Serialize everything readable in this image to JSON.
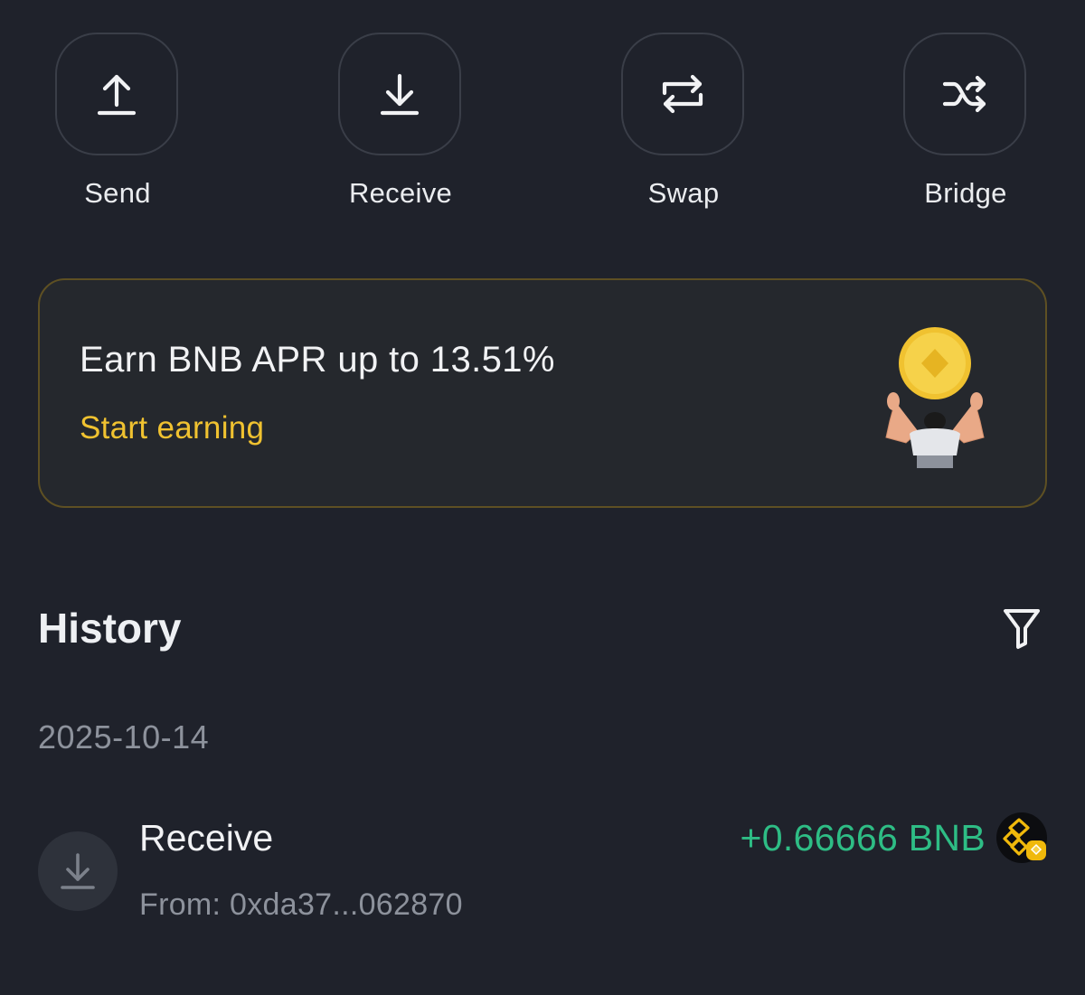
{
  "actions": [
    {
      "label": "Send",
      "icon": "arrow-up-icon"
    },
    {
      "label": "Receive",
      "icon": "arrow-down-icon"
    },
    {
      "label": "Swap",
      "icon": "swap-arrows-icon"
    },
    {
      "label": "Bridge",
      "icon": "shuffle-icon"
    }
  ],
  "promo": {
    "title": "Earn BNB APR up to 13.51%",
    "cta": "Start earning",
    "illustration": "person-holding-coin-illustration"
  },
  "history": {
    "title": "History",
    "filter_icon": "filter-icon",
    "groups": [
      {
        "date": "2025-10-14",
        "transactions": [
          {
            "type": "Receive",
            "from": "From: 0xda37...062870",
            "amount": "+0.66666 BNB",
            "token_icon": "bnb-token-icon"
          }
        ]
      }
    ]
  },
  "colors": {
    "background": "#1f222b",
    "accent": "#f0c230",
    "positive": "#2ebd85",
    "muted_text": "#8d929c",
    "promo_border": "#5e5023"
  }
}
